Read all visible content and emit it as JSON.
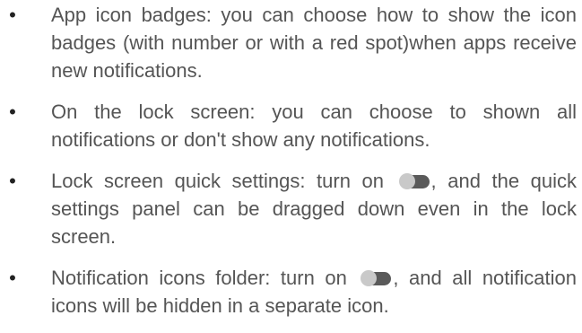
{
  "colors": {
    "text": "#555555",
    "bullet": "#222222",
    "toggle_knob": "#c9c9c9",
    "toggle_track": "#5a5a5a"
  },
  "items": [
    {
      "text": "App icon badges: you can choose how to show the icon badges (with number or with a red spot)when apps receive new notifications."
    },
    {
      "text": "On the lock screen: you can choose to shown all notifications or don't show any notifications."
    },
    {
      "text_before": "Lock screen quick settings: turn on",
      "toggle_icon": "toggle-switch-icon",
      "text_after": ", and the quick settings panel can be dragged down even in the lock screen."
    },
    {
      "text_before": "Notification icons folder: turn on",
      "toggle_icon": "toggle-switch-icon",
      "text_after": ", and all notification icons will be hidden in a separate icon."
    }
  ]
}
